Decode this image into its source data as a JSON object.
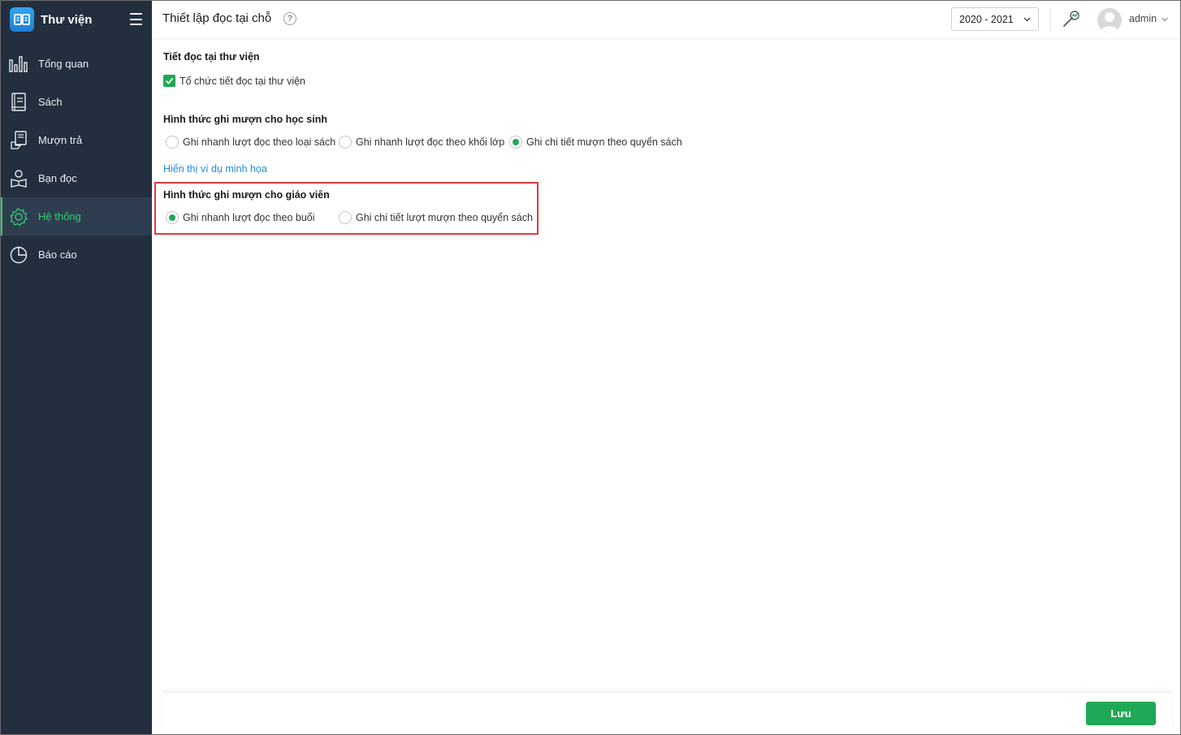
{
  "app": {
    "title": "Thư viện"
  },
  "sidebar": {
    "items": [
      {
        "label": "Tổng quan",
        "icon": "bar-chart-icon",
        "active": false
      },
      {
        "label": "Sách",
        "icon": "book-icon",
        "active": false
      },
      {
        "label": "Mượn trả",
        "icon": "borrow-return-icon",
        "active": false
      },
      {
        "label": "Bạn đọc",
        "icon": "reader-icon",
        "active": false
      },
      {
        "label": "Hệ thống",
        "icon": "gear-icon",
        "active": true
      },
      {
        "label": "Báo cáo",
        "icon": "pie-chart-icon",
        "active": false
      }
    ]
  },
  "header": {
    "title": "Thiết lập đọc tại chỗ",
    "help_symbol": "?",
    "year": "2020 - 2021",
    "user": "admin"
  },
  "reading_period": {
    "title": "Tiết đọc tại thư viện",
    "checkbox_label": "Tổ chức tiết đọc tại thư viện",
    "checked": true
  },
  "students": {
    "title": "Hình thức ghi mượn cho học sinh",
    "options": [
      {
        "label": "Ghi nhanh lượt đọc theo loại sách",
        "selected": false
      },
      {
        "label": "Ghi nhanh lượt đọc theo khối lớp",
        "selected": false
      },
      {
        "label": "Ghi chi tiết mượn theo quyển sách",
        "selected": true
      }
    ],
    "example_link": "Hiển thị ví dụ minh họa"
  },
  "teachers": {
    "title": "Hình thức ghi mượn cho giáo viên",
    "options": [
      {
        "label": "Ghi nhanh lượt đọc theo buổi",
        "selected": true
      },
      {
        "label": "Ghi chi tiết lượt mượn theo quyển sách",
        "selected": false
      }
    ]
  },
  "footer": {
    "save_label": "Lưu"
  },
  "colors": {
    "sidebar_bg": "#232f3e",
    "accent_green": "#1fa855",
    "active_text": "#2fcf6b",
    "link_blue": "#1a8ee0",
    "highlight_red": "#e23b3b"
  }
}
